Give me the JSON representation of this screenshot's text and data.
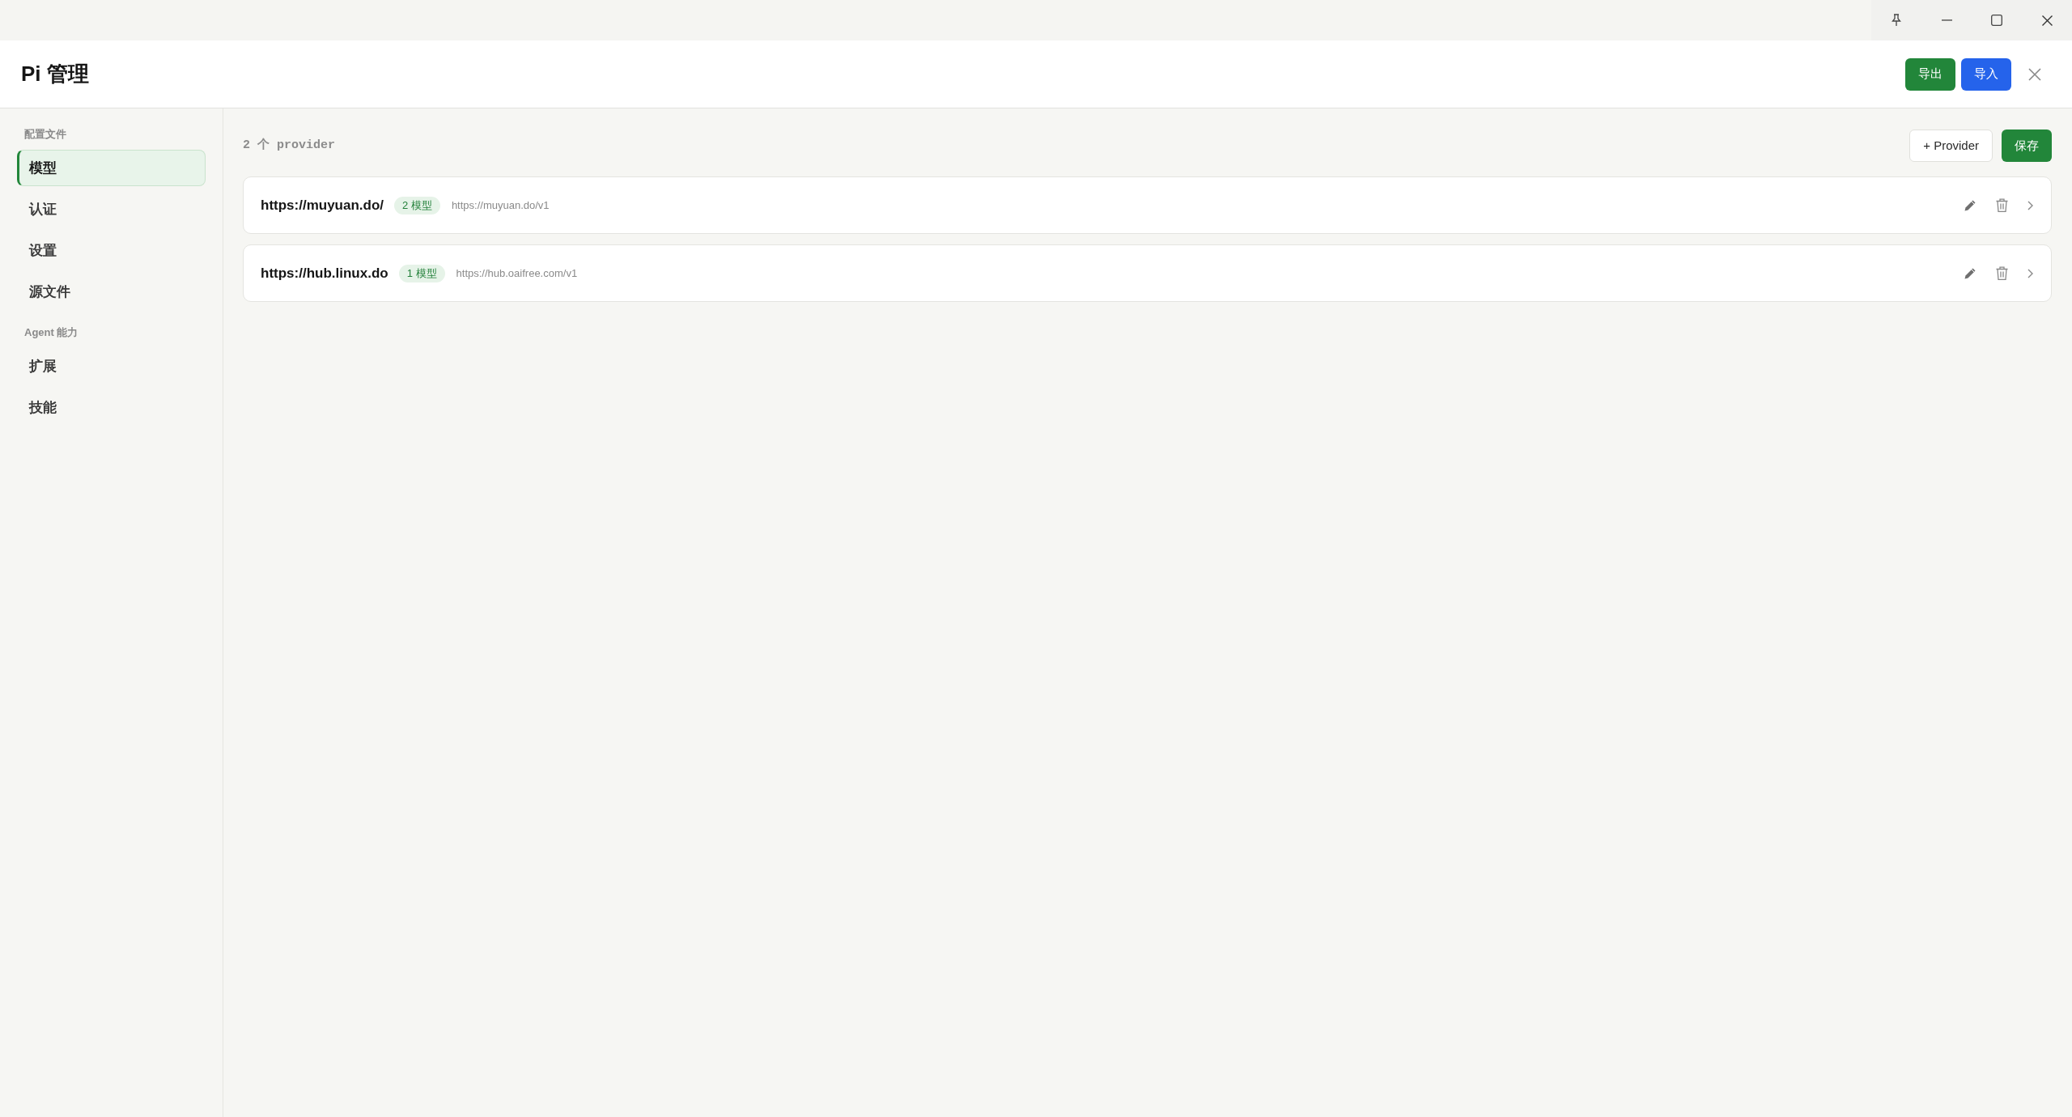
{
  "header": {
    "title": "Pi 管理",
    "buttons": [
      {
        "label": "导出",
        "kind": "success"
      },
      {
        "label": "导入",
        "kind": "primary"
      }
    ]
  },
  "sidebar": {
    "sections": [
      {
        "label": "配置文件",
        "items": [
          {
            "label": "模型",
            "selected": true
          },
          {
            "label": "认证",
            "selected": false
          },
          {
            "label": "设置",
            "selected": false
          },
          {
            "label": "源文件",
            "selected": false
          }
        ]
      },
      {
        "label": "Agent 能力",
        "items": [
          {
            "label": "扩展",
            "selected": false
          },
          {
            "label": "技能",
            "selected": false
          }
        ]
      }
    ]
  },
  "toolbar": {
    "count": "2 个 provider",
    "buttons": [
      {
        "label": "+ Provider",
        "kind": "outline"
      },
      {
        "label": "保存",
        "kind": "success"
      }
    ]
  },
  "providers": [
    {
      "name": "https://muyuan.do/",
      "model_count": "2 模型",
      "base_url": "https://muyuan.do/v1"
    },
    {
      "name": "https://hub.linux.do",
      "model_count": "1 模型",
      "base_url": "https://hub.oaifree.com/v1"
    }
  ]
}
